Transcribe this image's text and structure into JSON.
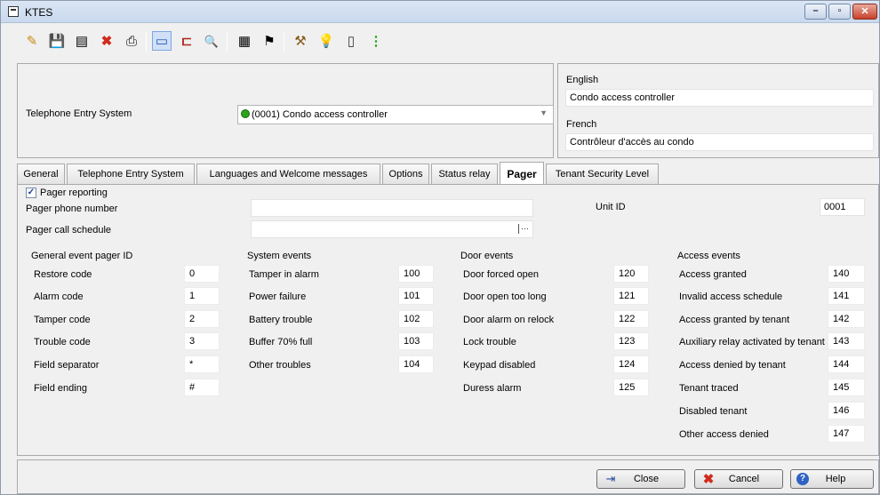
{
  "window": {
    "title": "KTES",
    "min": "–",
    "max": "▫",
    "close": "✕"
  },
  "toolbar": {
    "new": "✎",
    "save": "💾",
    "save_close": "▤",
    "delete": "✖",
    "print": "⎙",
    "edit": "▭",
    "link": "⊏",
    "search": "🔍",
    "report": "▦",
    "finish": "⚑",
    "tools": "⚒",
    "hint": "💡",
    "door": "▯",
    "status": "⋮"
  },
  "colors": {
    "accent": "#3a6fc4",
    "delete": "#d12a1c",
    "green": "#2aa31b"
  },
  "header": {
    "system_label": "Telephone Entry System",
    "controller_value": "(0001) Condo access controller",
    "english_label": "English",
    "english_value": "Condo access controller",
    "french_label": "French",
    "french_value": "Contrôleur d'accès au condo"
  },
  "tabs": [
    "General",
    "Telephone Entry System",
    "Languages and Welcome messages",
    "Options",
    "Status relay",
    "Pager",
    "Tenant Security Level"
  ],
  "pager": {
    "reporting_label": "Pager reporting",
    "reporting_checked": true,
    "phone_label": "Pager phone number",
    "phone_value": "",
    "schedule_label": "Pager call schedule",
    "schedule_value": "",
    "unit_label": "Unit ID",
    "unit_value": "0001"
  },
  "general_events": {
    "title": "General event pager ID",
    "rows": [
      {
        "label": "Restore code",
        "value": "0"
      },
      {
        "label": "Alarm code",
        "value": "1"
      },
      {
        "label": "Tamper code",
        "value": "2"
      },
      {
        "label": "Trouble code",
        "value": "3"
      },
      {
        "label": "Field separator",
        "value": "*"
      },
      {
        "label": "Field ending",
        "value": "#"
      }
    ]
  },
  "system_events": {
    "title": "System events",
    "rows": [
      {
        "label": "Tamper in alarm",
        "value": "100"
      },
      {
        "label": "Power failure",
        "value": "101"
      },
      {
        "label": "Battery trouble",
        "value": "102"
      },
      {
        "label": "Buffer 70% full",
        "value": "103"
      },
      {
        "label": "Other troubles",
        "value": "104"
      }
    ]
  },
  "door_events": {
    "title": "Door events",
    "rows": [
      {
        "label": "Door forced open",
        "value": "120"
      },
      {
        "label": "Door open too long",
        "value": "121"
      },
      {
        "label": "Door alarm on relock",
        "value": "122"
      },
      {
        "label": "Lock trouble",
        "value": "123"
      },
      {
        "label": "Keypad disabled",
        "value": "124"
      },
      {
        "label": "Duress alarm",
        "value": "125"
      }
    ]
  },
  "access_events": {
    "title": "Access events",
    "rows": [
      {
        "label": "Access granted",
        "value": "140"
      },
      {
        "label": "Invalid access schedule",
        "value": "141"
      },
      {
        "label": "Access granted by tenant",
        "value": "142"
      },
      {
        "label": "Auxiliary relay activated by tenant",
        "value": "143"
      },
      {
        "label": "Access denied by tenant",
        "value": "144"
      },
      {
        "label": "Tenant traced",
        "value": "145"
      },
      {
        "label": "Disabled tenant",
        "value": "146"
      },
      {
        "label": "Other access denied",
        "value": "147"
      }
    ]
  },
  "footer": {
    "close": "Close",
    "cancel": "Cancel",
    "help": "Help"
  }
}
